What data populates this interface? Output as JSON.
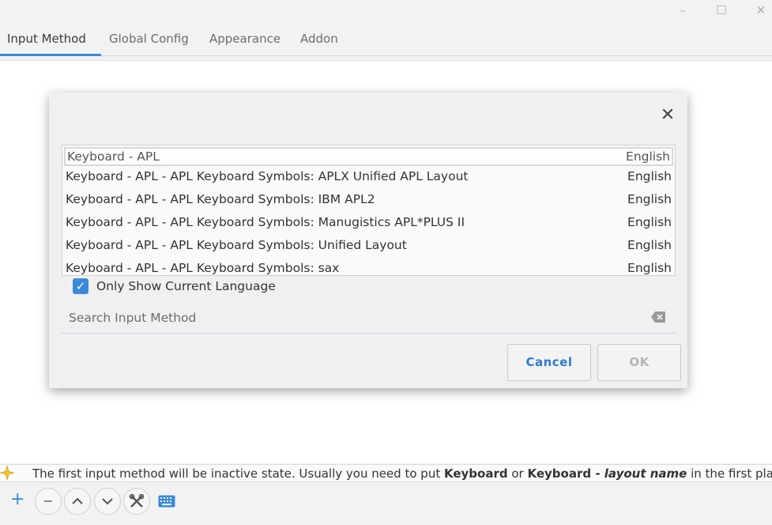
{
  "window": {
    "controls": {
      "minimize": "–",
      "maximize": "☐",
      "close": "✕"
    }
  },
  "tabs": [
    {
      "label": "Input Method"
    },
    {
      "label": "Global Config"
    },
    {
      "label": "Appearance"
    },
    {
      "label": "Addon"
    }
  ],
  "dialog": {
    "close_glyph": "✕",
    "list": [
      {
        "name": "Keyboard - APL",
        "lang": "English"
      },
      {
        "name": "Keyboard - APL - APL Keyboard Symbols: APLX Unified APL Layout",
        "lang": "English"
      },
      {
        "name": "Keyboard - APL - APL Keyboard Symbols: IBM APL2",
        "lang": "English"
      },
      {
        "name": "Keyboard - APL - APL Keyboard Symbols: Manugistics APL*PLUS II",
        "lang": "English"
      },
      {
        "name": "Keyboard - APL - APL Keyboard Symbols: Unified Layout",
        "lang": "English"
      },
      {
        "name": "Keyboard - APL - APL Keyboard Symbols: sax",
        "lang": "English"
      }
    ],
    "only_current_language": {
      "label": "Only Show Current Language",
      "checked": true
    },
    "search": {
      "placeholder": "Search Input Method",
      "value": ""
    },
    "cancel_label": "Cancel",
    "ok_label": "OK"
  },
  "hint": {
    "part1": "The first input method will be inactive state. Usually you need to put ",
    "bold1": "Keyboard",
    "part2": " or ",
    "bold2": "Keyboard - ",
    "italic": "layout name",
    "part3": " in the first place."
  },
  "toolbar": {
    "add": "+",
    "remove": "−",
    "up": "⌃",
    "down": "⌄"
  },
  "colors": {
    "accent": "#3b8ad8",
    "hint_icon": "#f2c330"
  }
}
